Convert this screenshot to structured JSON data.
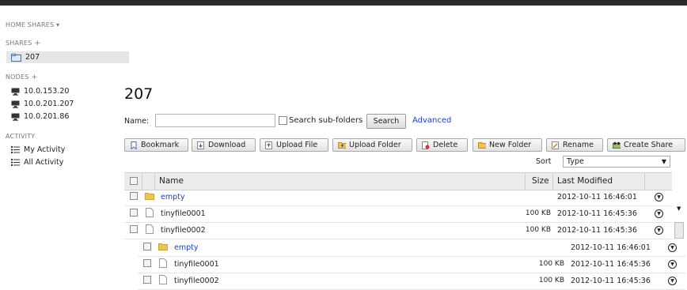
{
  "sidebar": {
    "home_shares": "HOME SHARES",
    "shares_header": "SHARES",
    "shares": [
      "207"
    ],
    "nodes_header": "NODES",
    "nodes": [
      "10.0.153.20",
      "10.0.201.207",
      "10.0.201.86"
    ],
    "activity_header": "ACTIVITY",
    "activity": [
      "My Activity",
      "All Activity"
    ]
  },
  "main": {
    "title": "207",
    "name_label": "Name:",
    "name_value": "",
    "search_subfolders": "Search sub-folders",
    "search_button": "Search",
    "advanced_link": "Advanced",
    "toolbar": [
      "Bookmark",
      "Download",
      "Upload File",
      "Upload Folder",
      "Delete",
      "New Folder",
      "Rename",
      "Create Share"
    ],
    "sort_label": "Sort",
    "sort_value": "Type"
  },
  "table": {
    "headers": {
      "name": "Name",
      "size": "Size",
      "modified": "Last Modified"
    },
    "rows": [
      {
        "name": "empty",
        "type": "folder",
        "size": "",
        "modified": "2012-10-11 16:46:01"
      },
      {
        "name": "tinyfile0001",
        "type": "file",
        "size": "100 KB",
        "modified": "2012-10-11 16:45:36"
      },
      {
        "name": "tinyfile0002",
        "type": "file",
        "size": "100 KB",
        "modified": "2012-10-11 16:45:36"
      }
    ],
    "dup_rows": [
      {
        "name": "empty",
        "type": "folder",
        "size": "",
        "modified": "2012-10-11 16:46:01"
      },
      {
        "name": "tinyfile0001",
        "type": "file",
        "size": "100 KB",
        "modified": "2012-10-11 16:45:36"
      },
      {
        "name": "tinyfile0002",
        "type": "file",
        "size": "100 KB",
        "modified": "2012-10-11 16:45:36"
      }
    ]
  },
  "colors": {
    "link": "#1a3fd0",
    "topbar": "#2b2b2b",
    "folder": "#f2c14e"
  }
}
